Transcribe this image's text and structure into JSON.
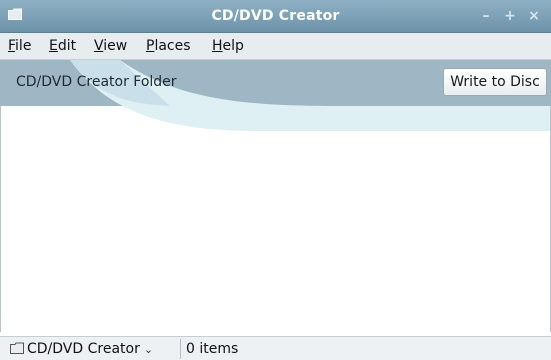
{
  "window": {
    "title": "CD/DVD Creator",
    "controls": {
      "minimize": "–",
      "maximize": "+",
      "close": "×"
    }
  },
  "menubar": {
    "items": [
      {
        "label_first": "F",
        "label_rest": "ile"
      },
      {
        "label_first": "E",
        "label_rest": "dit"
      },
      {
        "label_first": "V",
        "label_rest": "iew"
      },
      {
        "label_first": "P",
        "label_rest": "laces"
      },
      {
        "label_first": "H",
        "label_rest": "elp"
      }
    ]
  },
  "header": {
    "folder_label": "CD/DVD Creator Folder",
    "write_button_label": "Write to Disc"
  },
  "statusbar": {
    "location_label": "CD/DVD Creator",
    "items_count": "0 items"
  },
  "colors": {
    "titlebar": "#7fa2b7",
    "header_band": "#9fb7c5",
    "swoosh": "#dfeef4"
  }
}
